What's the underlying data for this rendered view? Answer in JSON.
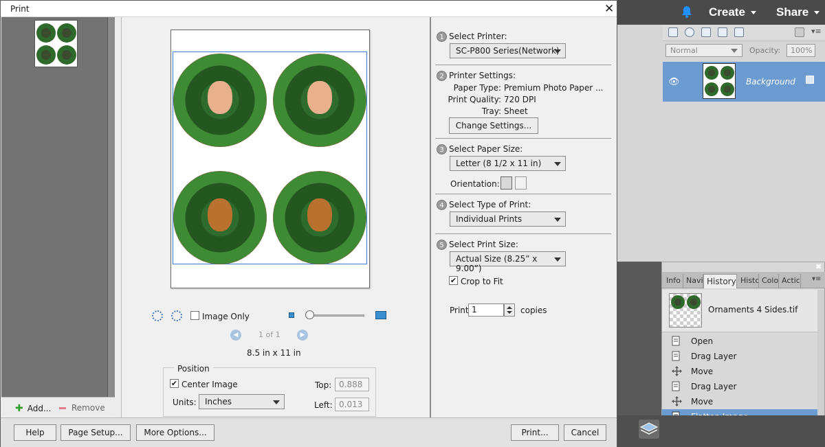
{
  "app": {
    "create_label": "Create",
    "share_label": "Share",
    "layers": {
      "blend_mode": "Normal",
      "opacity_label": "Opacity:",
      "opacity_value": "100%",
      "layer_name": "Background"
    },
    "history": {
      "tabs": [
        "Info",
        "Navi",
        "History",
        "Histo",
        "Colo",
        "Actic"
      ],
      "snapshot_name": "Ornaments 4 Sides.tif",
      "items": [
        "Open",
        "Drag Layer",
        "Move",
        "Drag Layer",
        "Move",
        "Flatten Image"
      ],
      "selected_index": 5
    }
  },
  "dialog": {
    "title": "Print",
    "thumbs": {
      "add_label": "Add...",
      "remove_label": "Remove"
    },
    "preview": {
      "image_only_label": "Image Only",
      "page_counter": "1 of 1",
      "page_size": "8.5 in x 11 in"
    },
    "position": {
      "legend": "Position",
      "center_image_label": "Center Image",
      "center_image_checked": true,
      "units_label": "Units:",
      "units_value": "Inches",
      "top_label": "Top:",
      "top_value": "0.888",
      "left_label": "Left:",
      "left_value": "0.013"
    },
    "settings": {
      "step1": {
        "num": "1",
        "label": "Select Printer:",
        "value": "SC-P800 Series(Network)"
      },
      "step2": {
        "num": "2",
        "label": "Printer Settings:",
        "paper_type_key": "Paper Type:",
        "paper_type_value": "Premium Photo Paper ...",
        "print_quality_key": "Print Quality:",
        "print_quality_value": "720 DPI",
        "tray_key": "Tray:",
        "tray_value": "Sheet",
        "change_button": "Change Settings..."
      },
      "step3": {
        "num": "3",
        "label": "Select Paper Size:",
        "value": "Letter (8 1/2 x 11 in)",
        "orientation_label": "Orientation:"
      },
      "step4": {
        "num": "4",
        "label": "Select Type of Print:",
        "value": "Individual Prints"
      },
      "step5": {
        "num": "5",
        "label": "Select Print Size:",
        "value": "Actual Size (8.25” x 9.00”)"
      },
      "crop_to_fit_label": "Crop to Fit",
      "crop_to_fit_checked": true,
      "print_label": "Print",
      "copies_value": "1",
      "copies_label": "copies"
    },
    "footer": {
      "help": "Help",
      "page_setup": "Page Setup...",
      "more_options": "More Options...",
      "print": "Print...",
      "cancel": "Cancel"
    }
  },
  "colors": {
    "accent_blue": "#6c9bd2",
    "wreath_red": "#c41d1d",
    "guide_blue": "#3a7bd5"
  }
}
